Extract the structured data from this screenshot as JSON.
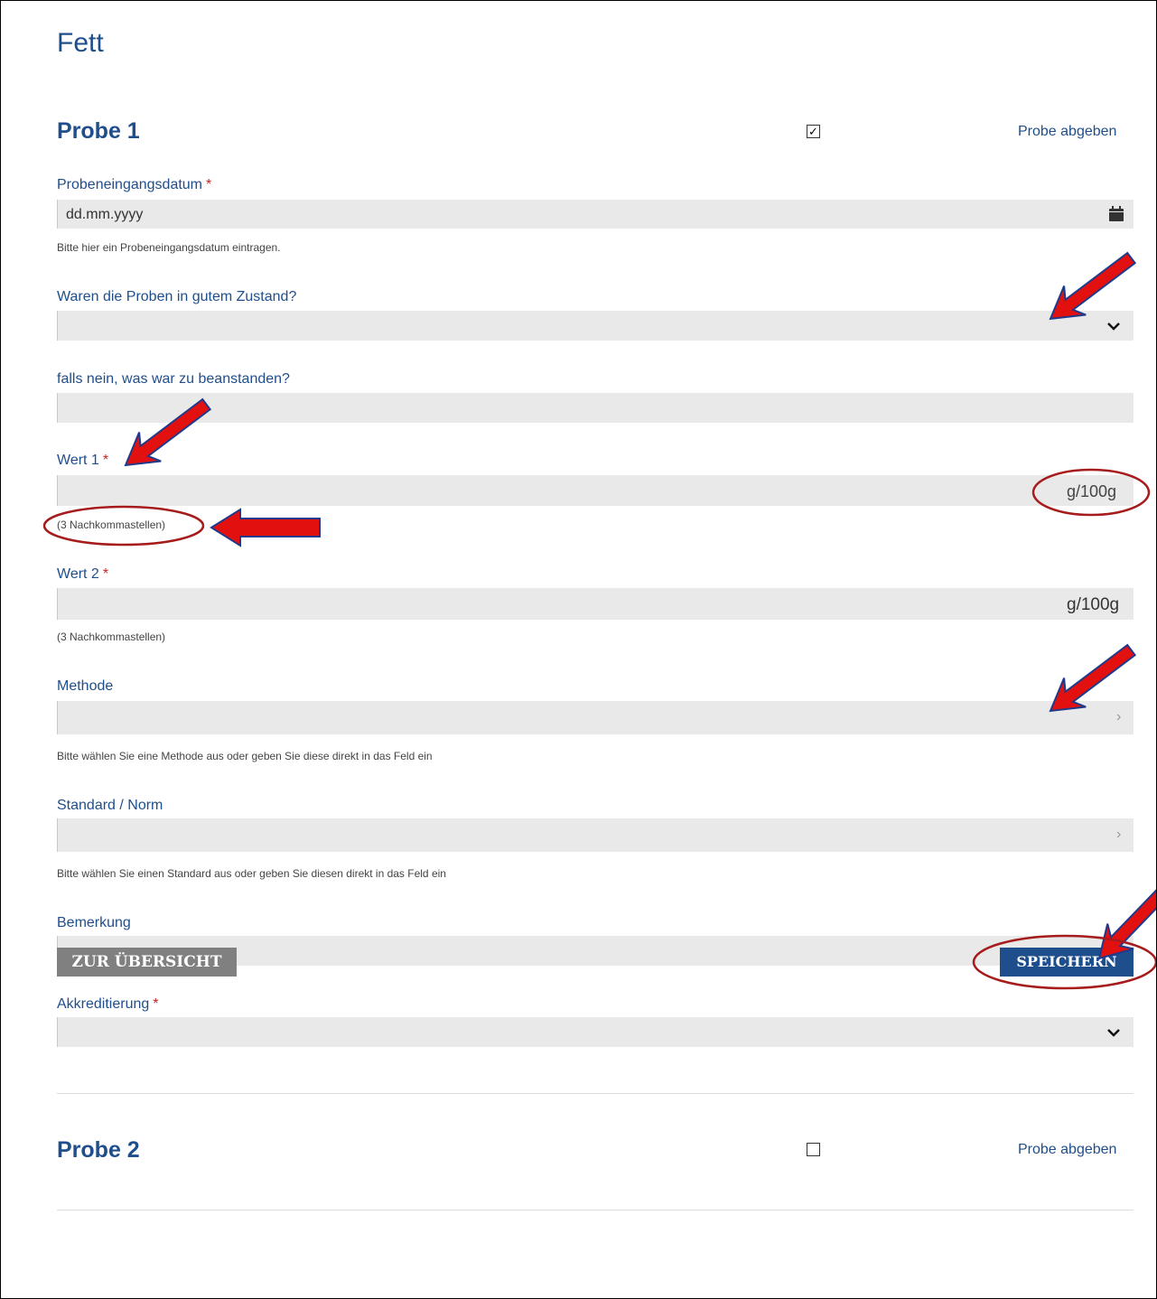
{
  "page": {
    "title": "Fett"
  },
  "probe1": {
    "title": "Probe 1",
    "checked_mark": "✓",
    "submit_label": "Probe abgeben",
    "fields": {
      "date": {
        "label": "Probeneingangsdatum",
        "required": "*",
        "placeholder": "dd.mm.yyyy",
        "hint": "Bitte hier ein Probeneingangsdatum eintragen.",
        "icon": "calendar-icon"
      },
      "condition": {
        "label": "Waren die Proben in gutem Zustand?",
        "icon": "chevron-down-icon"
      },
      "complaint": {
        "label": "falls nein, was war zu beanstanden?"
      },
      "value1": {
        "label": "Wert 1",
        "required": "*",
        "unit": "g/100g",
        "hint": "(3 Nachkommastellen)"
      },
      "value2": {
        "label": "Wert 2",
        "required": "*",
        "unit": "g/100g",
        "hint": "(3 Nachkommastellen)"
      },
      "method": {
        "label": "Methode",
        "hint": "Bitte wählen Sie eine Methode aus oder geben Sie diese direkt in das Feld ein",
        "icon": "chevron-right-icon"
      },
      "standard": {
        "label": "Standard / Norm",
        "hint": "Bitte wählen Sie einen Standard aus oder geben Sie diesen direkt in das Feld ein",
        "icon": "chevron-right-icon"
      },
      "remark": {
        "label": "Bemerkung"
      },
      "accreditation": {
        "label": "Akkreditierung",
        "required": "*",
        "icon": "chevron-down-icon"
      }
    }
  },
  "probe2": {
    "title": "Probe 2",
    "submit_label": "Probe abgeben"
  },
  "footer": {
    "back_label": "ZUR ÜBERSICHT",
    "save_label": "SPEICHERN"
  },
  "colors": {
    "accent": "#1f4e8c",
    "field_bg": "#e9e9e9",
    "required": "#cc2222",
    "annotation": "#e31010",
    "back_button": "#808080"
  }
}
